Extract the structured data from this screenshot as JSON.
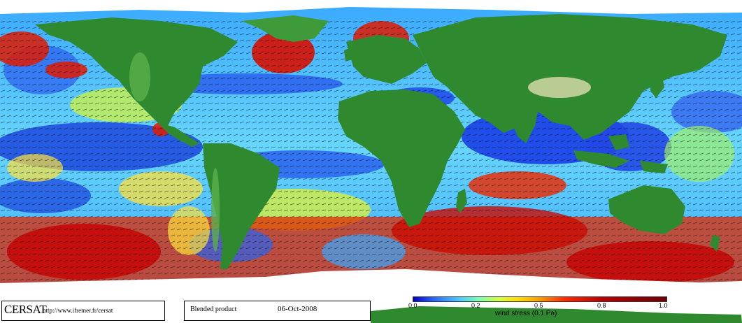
{
  "map": {
    "colors": {
      "land": "#2f8a2f",
      "land_light": "#5caf4c",
      "highland": "#c9d3a0",
      "ice": "#ffffff",
      "low": "#1436d8",
      "mid_low": "#35b4ff",
      "mid": "#c8f04a",
      "mid_high": "#ffb000",
      "high": "#e01e00"
    }
  },
  "footer": {
    "logo": "CERSAT",
    "url": "http://www.ifremer.fr/cersat",
    "product": "Blended product",
    "date": "06-Oct-2008"
  },
  "colorbar": {
    "ticks": [
      "0.0",
      "0.2",
      "0.5",
      "0.8",
      "1.0"
    ],
    "label": "wind stress (0.1 Pa)"
  }
}
